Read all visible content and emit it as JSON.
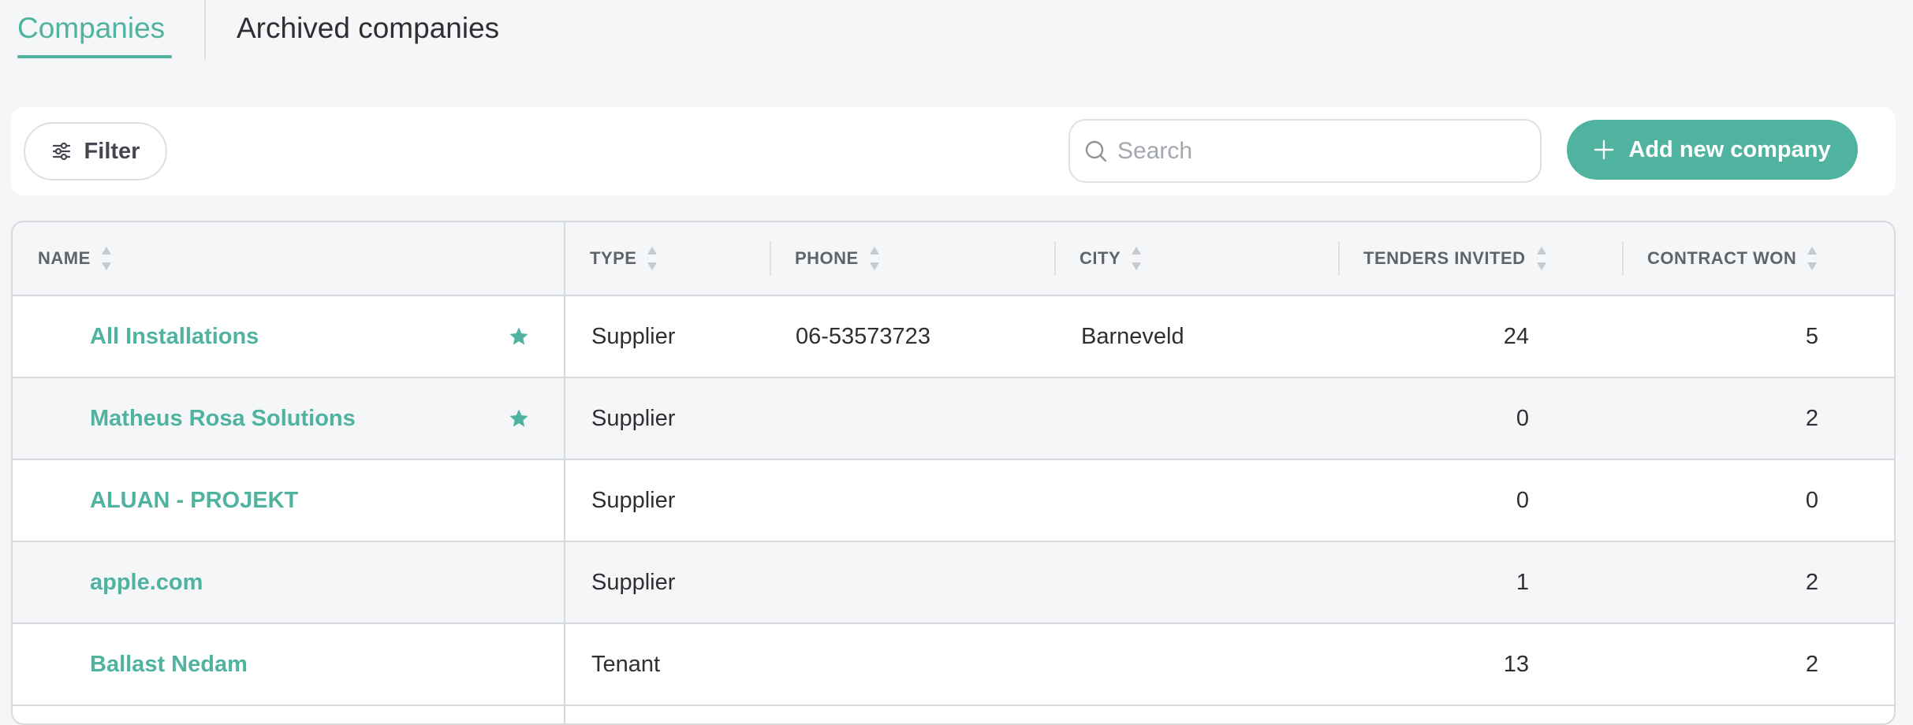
{
  "tabs": {
    "companies": "Companies",
    "archived": "Archived companies"
  },
  "toolbar": {
    "filter_label": "Filter",
    "filter_icon": "sliders-icon",
    "search_placeholder": "Search",
    "search_value": "",
    "search_icon": "search-icon",
    "add_label": "Add new company",
    "add_icon": "plus-icon"
  },
  "colors": {
    "accent": "#4fb3a0",
    "background": "#f5f6f8",
    "text": "#2d2f33"
  },
  "table": {
    "columns": {
      "name": "NAME",
      "type": "TYPE",
      "phone": "PHONE",
      "city": "CITY",
      "tenders": "TENDERS INVITED",
      "contracts": "CONTRACT WON"
    },
    "rows": [
      {
        "name": "All Installations",
        "starred": true,
        "type": "Supplier",
        "phone": "06-53573723",
        "city": "Barneveld",
        "tenders": "24",
        "contracts": "5"
      },
      {
        "name": "Matheus Rosa Solutions",
        "starred": true,
        "type": "Supplier",
        "phone": "",
        "city": "",
        "tenders": "0",
        "contracts": "2"
      },
      {
        "name": "ALUAN - PROJEKT",
        "starred": false,
        "type": "Supplier",
        "phone": "",
        "city": "",
        "tenders": "0",
        "contracts": "0"
      },
      {
        "name": "apple.com",
        "starred": false,
        "type": "Supplier",
        "phone": "",
        "city": "",
        "tenders": "1",
        "contracts": "2"
      },
      {
        "name": "Ballast Nedam",
        "starred": false,
        "type": "Tenant",
        "phone": "",
        "city": "",
        "tenders": "13",
        "contracts": "2"
      }
    ]
  }
}
